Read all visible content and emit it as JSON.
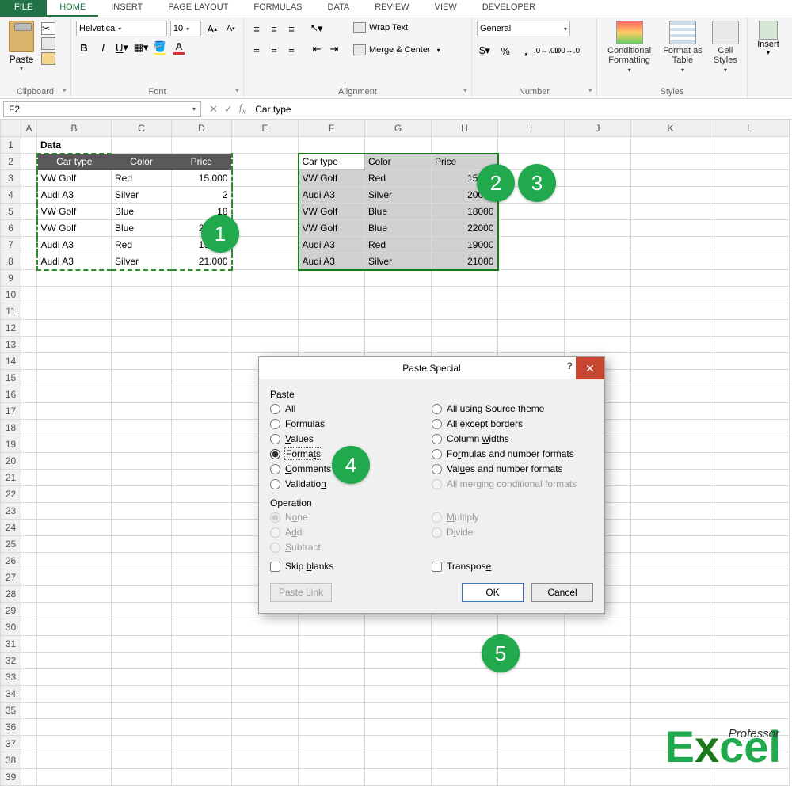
{
  "tabs": {
    "file": "FILE",
    "home": "HOME",
    "insert": "INSERT",
    "page": "PAGE LAYOUT",
    "formulas": "FORMULAS",
    "data": "DATA",
    "review": "REVIEW",
    "view": "VIEW",
    "developer": "DEVELOPER"
  },
  "ribbon": {
    "clipboard": {
      "paste": "Paste",
      "label": "Clipboard"
    },
    "font": {
      "name": "Helvetica",
      "size": "10",
      "label": "Font"
    },
    "align": {
      "wrap": "Wrap Text",
      "merge": "Merge & Center",
      "label": "Alignment"
    },
    "number": {
      "format": "General",
      "label": "Number"
    },
    "styles": {
      "cond": "Conditional Formatting",
      "tbl": "Format as Table",
      "cell": "Cell Styles",
      "label": "Styles"
    },
    "cells": {
      "insert": "Insert"
    }
  },
  "fx": {
    "namebox": "F2",
    "formula": "Car type"
  },
  "cols": [
    "A",
    "B",
    "C",
    "D",
    "E",
    "F",
    "G",
    "H",
    "I",
    "J",
    "K",
    "L"
  ],
  "title": "Data",
  "headers": [
    "Car type",
    "Color",
    "Price"
  ],
  "rows": [
    {
      "type": "VW Golf",
      "color": "Red",
      "price": "15.000",
      "p2": "15000"
    },
    {
      "type": "Audi A3",
      "color": "Silver",
      "price": "2",
      "p2": "20000"
    },
    {
      "type": "VW Golf",
      "color": "Blue",
      "price": "18",
      "p2": "18000"
    },
    {
      "type": "VW Golf",
      "color": "Blue",
      "price": "22.000",
      "p2": "22000"
    },
    {
      "type": "Audi A3",
      "color": "Red",
      "price": "19.000",
      "p2": "19000"
    },
    {
      "type": "Audi A3",
      "color": "Silver",
      "price": "21.000",
      "p2": "21000"
    }
  ],
  "badges": {
    "1": "1",
    "2": "2",
    "3": "3",
    "4": "4",
    "5": "5"
  },
  "dialog": {
    "title": "Paste Special",
    "pasteLabel": "Paste",
    "left": [
      "All",
      "Formulas",
      "Values",
      "Formats",
      "Comments",
      "Validation"
    ],
    "right": [
      "All using Source theme",
      "All except borders",
      "Column widths",
      "Formulas and number formats",
      "Values and number formats",
      "All merging conditional formats"
    ],
    "opLabel": "Operation",
    "opsLeft": [
      "None",
      "Add",
      "Subtract"
    ],
    "opsRight": [
      "Multiply",
      "Divide"
    ],
    "skip": "Skip blanks",
    "transpose": "Transpose",
    "pasteLink": "Paste Link",
    "ok": "OK",
    "cancel": "Cancel"
  },
  "logo": {
    "small": "Professor",
    "big": "Excel"
  }
}
